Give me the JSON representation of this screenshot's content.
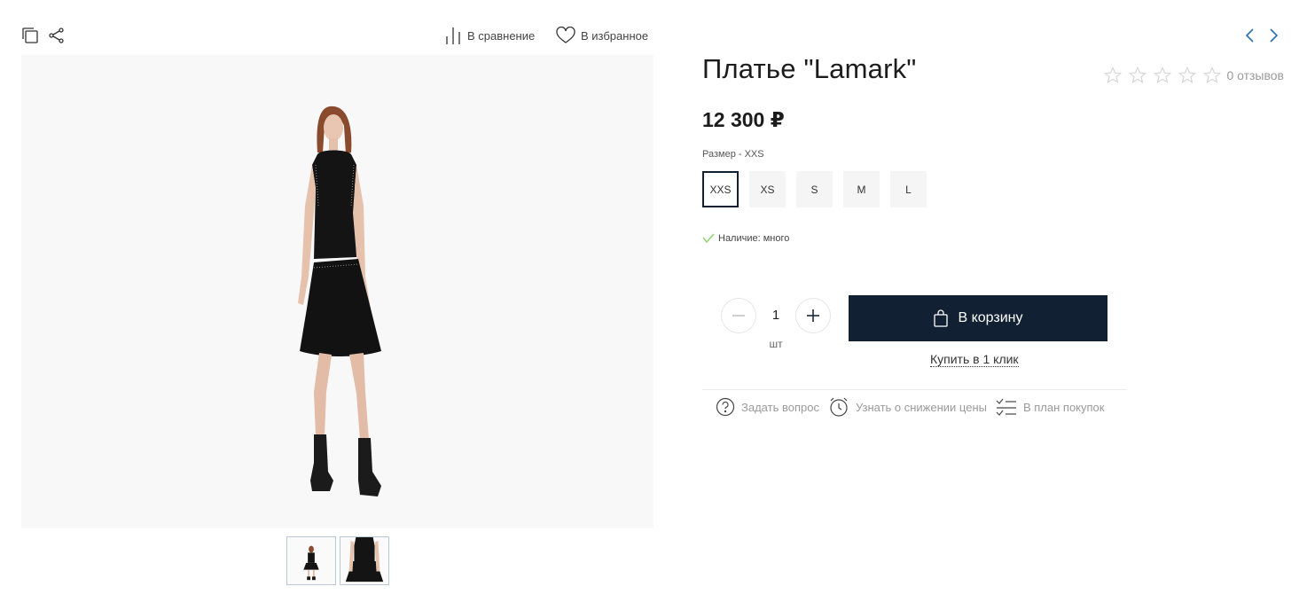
{
  "toolbar": {
    "copy_icon": "copy-icon",
    "share_icon": "share-icon",
    "compare_label": "В сравнение",
    "favorite_label": "В избранное"
  },
  "nav": {
    "prev_icon": "chevron-left-icon",
    "next_icon": "chevron-right-icon",
    "accent_color": "#2a6fb0"
  },
  "product": {
    "title": "Платье \"Lamark\"",
    "reviews_label": "0 отзывов",
    "rating": 0,
    "rating_max": 5,
    "price": "12 300 ₽",
    "size_label": "Размер - XXS",
    "sizes": [
      "XXS",
      "XS",
      "S",
      "M",
      "L"
    ],
    "selected_size": "XXS",
    "stock_label": "Наличие: много",
    "stock_color": "#8ccf6f"
  },
  "purchase": {
    "quantity": "1",
    "unit": "шт",
    "cart_label": "В корзину",
    "one_click_label": "Купить в 1 клик",
    "button_color": "#122033"
  },
  "extras": {
    "ask_label": "Задать вопрос",
    "price_drop_label": "Узнать о снижении цены",
    "plan_label": "В план покупок"
  },
  "gallery": {
    "thumb_count": 2
  }
}
